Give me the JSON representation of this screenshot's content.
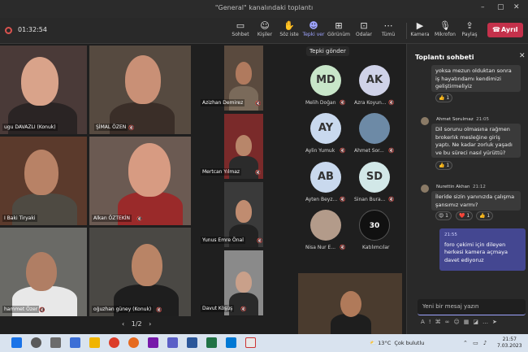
{
  "window": {
    "title": "\"General\" kanalındaki toplantı"
  },
  "toolbar": {
    "timer": "01:32:54",
    "buttons": [
      {
        "label": "Sohbet",
        "icon": "chat-icon"
      },
      {
        "label": "Kişiler",
        "icon": "people-icon"
      },
      {
        "label": "Söz iste",
        "icon": "hand-icon"
      },
      {
        "label": "Tepki ver",
        "icon": "reaction-icon"
      },
      {
        "label": "Görünüm",
        "icon": "layout-icon"
      },
      {
        "label": "Odalar",
        "icon": "rooms-icon"
      },
      {
        "label": "Tümü",
        "icon": "more-icon"
      },
      {
        "label": "Kamera",
        "icon": "camera-icon"
      },
      {
        "label": "Mikrofon",
        "icon": "microphone-icon"
      },
      {
        "label": "Paylaş",
        "icon": "share-icon"
      }
    ],
    "leave_label": "Ayrıl",
    "accent_color": "#9ea4ff",
    "leave_color": "#c4314b"
  },
  "video_tiles": [
    {
      "name": "ugu DAVAZLI (Konuk)"
    },
    {
      "name": "ŞİMAL ÖZEN"
    },
    {
      "name": "Azizhan Demirez"
    },
    {
      "name": "I Baki Tiryaki"
    },
    {
      "name": "Alkan ÖZTEKİN"
    },
    {
      "name": "Mertcan Yılmaz"
    },
    {
      "name": "Yunus Emre Önal"
    },
    {
      "name": "hammet Özer"
    },
    {
      "name": "oğuzhan güney (Konuk)"
    },
    {
      "name": "Davut Köşüş"
    }
  ],
  "pager": {
    "page": "1/2"
  },
  "reaction_tooltip": "Tepki gönder",
  "participants": [
    {
      "initials": "MD",
      "name": "Melih Doğan",
      "color": "#c8e6c9"
    },
    {
      "initials": "AK",
      "name": "Azra Koyun...",
      "color": "#cfd2e8"
    },
    {
      "initials": "AY",
      "name": "Aylin Yumuk",
      "color": "#c9d9ee"
    },
    {
      "initials": "",
      "name": "Ahmet Sor...",
      "color": "#6d8aa6"
    },
    {
      "initials": "AB",
      "name": "Ayten Beyz...",
      "color": "#c9d9ee"
    },
    {
      "initials": "SD",
      "name": "Sinan Bura...",
      "color": "#d2e8e8"
    },
    {
      "initials": "",
      "name": "Nisa Nur E...",
      "color": "#b39b8a"
    },
    {
      "initials": "30",
      "name": "Katılımcılar",
      "color": "#111111"
    }
  ],
  "chat": {
    "title": "Toplantı sohbeti",
    "messages": [
      {
        "sender": "",
        "time": "",
        "text": "yoksa mezun olduktan sonra iş hayatındamı kendimizi geliştirmeliyiz",
        "reactions": [
          "👍 1"
        ]
      },
      {
        "sender": "Ahmet Sorulmaz",
        "time": "21:05",
        "text": "Dil sorunu olmasına rağmen brokerlık mesleğine giriş yaptı. Ne kadar zorluk yaşadı ve bu süreci nasıl yürüttü?",
        "reactions": [
          "👍 1"
        ]
      },
      {
        "sender": "Nurettin Akhan",
        "time": "21:12",
        "text": "İleride sizin yanınızda çalışma şansımız varmı?",
        "reactions": [
          "😍 1",
          "❤️ 1",
          "👍 1"
        ]
      }
    ],
    "my_message": {
      "time": "21:55",
      "text": "foro çekimi için dileyen herkesi kamera açmaya davet ediyoruz"
    },
    "compose_placeholder": "Yeni bir mesaj yazın"
  },
  "taskbar": {
    "weather_temp": "13°C",
    "weather_text": "Çok bulutlu",
    "time": "21:57",
    "date": "7.03.2023"
  }
}
